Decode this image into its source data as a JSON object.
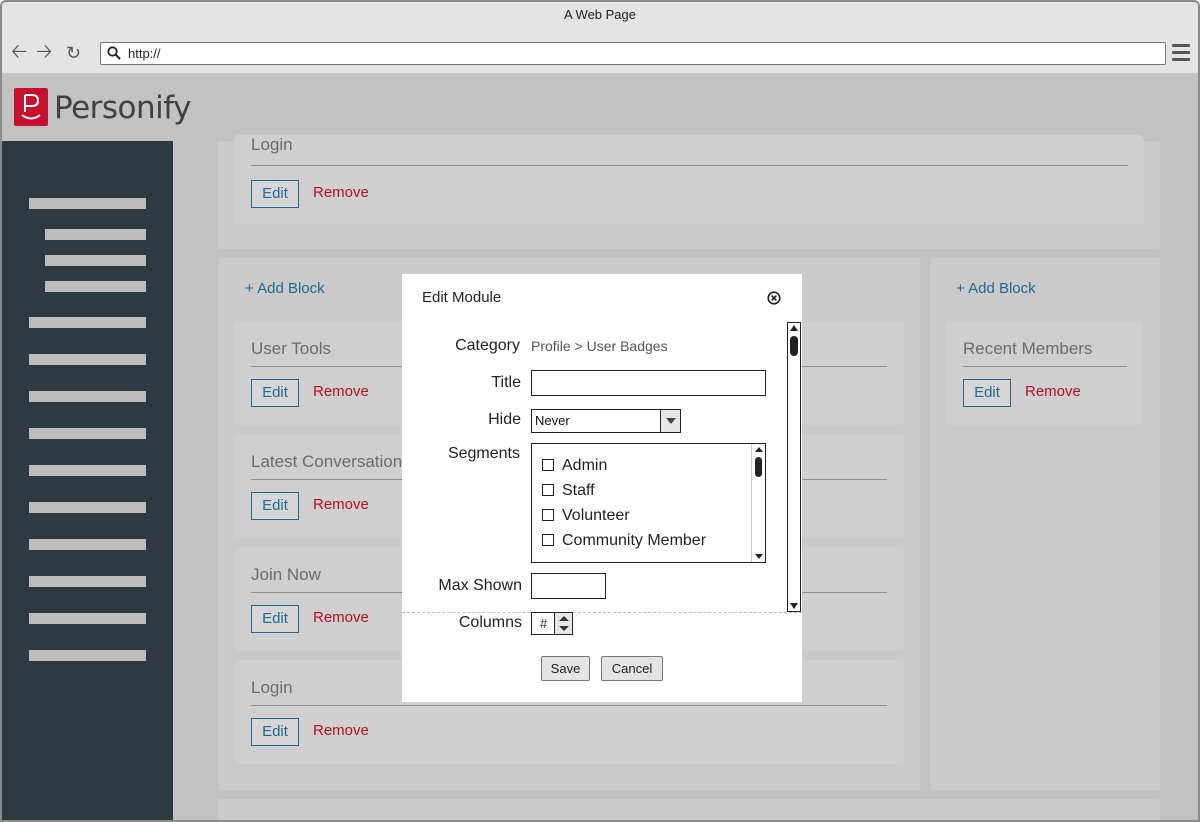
{
  "browser": {
    "window_title": "A Web Page",
    "url": "http://"
  },
  "app": {
    "logo_letter": "P",
    "logo_text": "Personify",
    "brand_color": "#c8102e",
    "sidebar_bg": "#2d3a42",
    "link_color": "#1d6b91",
    "remove_color": "#b9111b"
  },
  "top_card": {
    "title": "Login",
    "edit_label": "Edit",
    "remove_label": "Remove"
  },
  "left_column": {
    "add_block_label": "+ Add Block",
    "cards": [
      {
        "title": "User Tools",
        "edit_label": "Edit",
        "remove_label": "Remove"
      },
      {
        "title": "Latest Conversation",
        "edit_label": "Edit",
        "remove_label": "Remove"
      },
      {
        "title": "Join Now",
        "edit_label": "Edit",
        "remove_label": "Remove"
      },
      {
        "title": "Login",
        "edit_label": "Edit",
        "remove_label": "Remove"
      }
    ]
  },
  "right_column": {
    "add_block_label": "+ Add Block",
    "cards": [
      {
        "title": "Recent Members",
        "edit_label": "Edit",
        "remove_label": "Remove"
      }
    ]
  },
  "dialog": {
    "title": "Edit Module",
    "category_label": "Category",
    "category_value": "Profile > User Badges",
    "title_label": "Title",
    "title_value": "",
    "hide_label": "Hide",
    "hide_value": "Never",
    "segments_label": "Segments",
    "segments": [
      "Admin",
      "Staff",
      "Volunteer",
      "Community Member"
    ],
    "max_shown_label": "Max Shown",
    "max_shown_value": "",
    "columns_label": "Columns",
    "columns_value": "#",
    "save_label": "Save",
    "cancel_label": "Cancel"
  }
}
